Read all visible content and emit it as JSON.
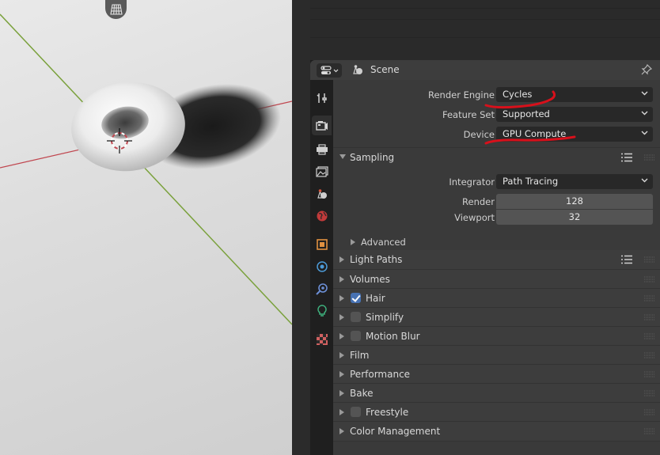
{
  "header": {
    "breadcrumb": "Scene"
  },
  "render": {
    "render_engine_label": "Render Engine",
    "render_engine_value": "Cycles",
    "feature_set_label": "Feature Set",
    "feature_set_value": "Supported",
    "device_label": "Device",
    "device_value": "GPU Compute"
  },
  "sampling": {
    "title": "Sampling",
    "integrator_label": "Integrator",
    "integrator_value": "Path Tracing",
    "render_label": "Render",
    "render_value": "128",
    "viewport_label": "Viewport",
    "viewport_value": "32",
    "advanced_title": "Advanced"
  },
  "panels": [
    {
      "title": "Light Paths",
      "checkbox": null,
      "has_list_icon": true
    },
    {
      "title": "Volumes",
      "checkbox": null
    },
    {
      "title": "Hair",
      "checkbox": true
    },
    {
      "title": "Simplify",
      "checkbox": false
    },
    {
      "title": "Motion Blur",
      "checkbox": false
    },
    {
      "title": "Film",
      "checkbox": null
    },
    {
      "title": "Performance",
      "checkbox": null
    },
    {
      "title": "Bake",
      "checkbox": null
    },
    {
      "title": "Freestyle",
      "checkbox": false
    },
    {
      "title": "Color Management",
      "checkbox": null
    }
  ],
  "tabs": [
    "tool-icon",
    "render-icon",
    "output-icon",
    "view-layer-icon",
    "scene-icon",
    "world-icon",
    "object-icon",
    "physics-icon",
    "constraints-icon",
    "light-data-icon",
    "texture-icon"
  ],
  "colors": {
    "annotation": "#d8101b",
    "checkbox_on": "#4772b3",
    "x_axis": "#c0464f",
    "y_axis": "#7aa13c"
  }
}
